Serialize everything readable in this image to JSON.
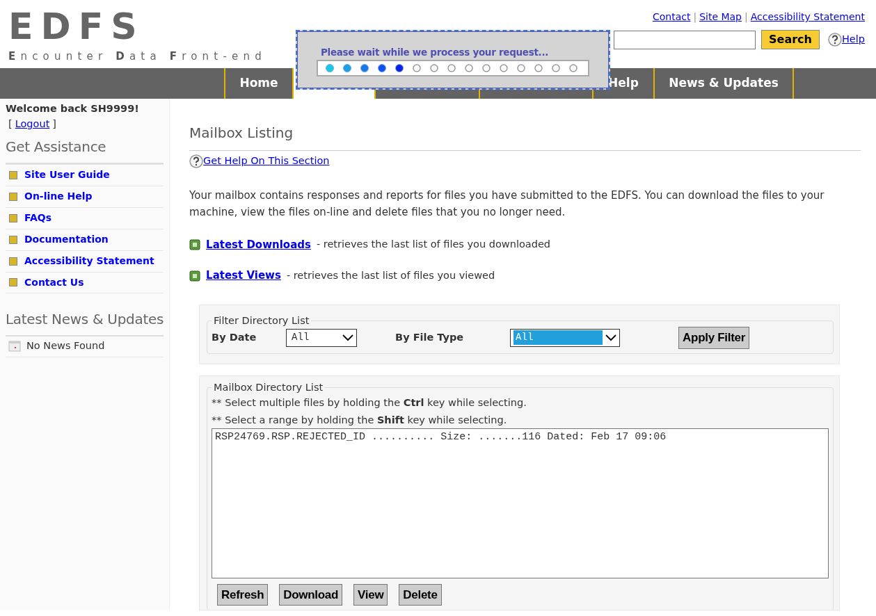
{
  "header": {
    "logo": "EDFS",
    "tagline": "**E**ncounter **D**ata **F**ront-end",
    "top_links": [
      "Contact",
      "Site Map",
      "Accessibility Statement"
    ],
    "link_separators": [
      "|",
      "|"
    ],
    "search": {
      "button": "Search"
    },
    "help_link": "Help"
  },
  "nav": [
    {
      "label": "Home",
      "selected": false
    },
    {
      "selected": true
    },
    {
      "selected": false
    },
    {
      "selected": false
    },
    {
      "label": "Help",
      "selected": false
    },
    {
      "label": "News & Updates",
      "selected": false
    }
  ],
  "overlay": {
    "message": "Please wait while we process your request...",
    "level": 0.333
  },
  "sidebar": {
    "welcome": "Welcome back SH9999!",
    "logout": "Logout",
    "logout_brackets": [
      "[",
      "]"
    ],
    "assistance_title": "Get Assistance",
    "links": [
      "Site User Guide",
      "On-line Help",
      "FAQs",
      "Documentation",
      "Accessibility Statement",
      "Contact Us"
    ],
    "news_title": "Latest News & Updates",
    "news": [
      "No News Found"
    ]
  },
  "main": {
    "title": "Mailbox Listing",
    "help_link": "Get Help On This Section",
    "intro": "Your mailbox contains responses and reports for files you have submitted to the EDFS. You can download the files to your machine, view the files on-line and delete files that you no longer need.",
    "quick_links": [
      {
        "link": "Latest Downloads",
        "text": "- retrieves the last list of files you downloaded"
      },
      {
        "link": "Latest Views",
        "text": "- retrieves the last list of files you viewed"
      }
    ],
    "filter": {
      "legend": "Filter Directory List",
      "fields": [
        {
          "label": "By Date",
          "value": "All",
          "focused": false
        },
        {
          "label": "By File Type",
          "value": "All",
          "focused": true
        }
      ],
      "button": "Apply Filter"
    },
    "mailbox": {
      "legend": "Mailbox Directory List",
      "hints": [
        "** Select multiple files by holding the **Ctrl** key while selecting.",
        "** Select a range by holding the **Shift** key while selecting."
      ],
      "files": [
        {
          "text": "RSP24769.RSP.REJECTED_ID .......... Size: .......116 Dated: Feb 17 09:06",
          "selected": false
        }
      ],
      "buttons": [
        "Refresh",
        "Download",
        "View",
        "Delete"
      ]
    }
  }
}
